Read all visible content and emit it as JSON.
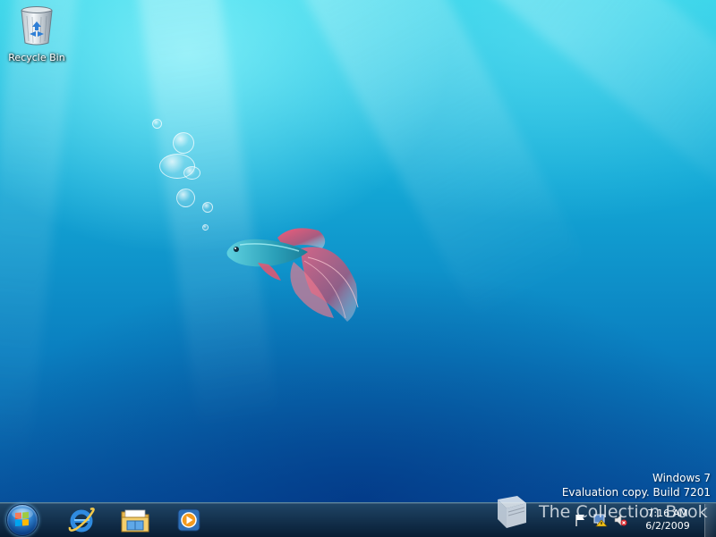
{
  "desktop": {
    "icons": [
      {
        "label": "Recycle Bin",
        "icon": "recycle-bin-icon"
      }
    ],
    "wallpaper": "betta-fish-underwater",
    "watermark": {
      "line1": "Windows 7",
      "line2": "Evaluation copy. Build 7201"
    },
    "site_watermark": "The Collection Book"
  },
  "taskbar": {
    "start": {
      "icon": "windows-start-orb-icon"
    },
    "pinned": [
      {
        "icon": "internet-explorer-icon"
      },
      {
        "icon": "windows-explorer-icon"
      },
      {
        "icon": "windows-media-player-icon"
      }
    ],
    "tray": {
      "icons": [
        "action-center-flag-icon",
        "network-disconnected-icon",
        "volume-muted-icon"
      ],
      "time": "7:16 AM",
      "date": "6/2/2009"
    }
  },
  "colors": {
    "wallpaper_top": "#2ed0e6",
    "wallpaper_bottom": "#07539e",
    "taskbar": "#0a2c4f"
  }
}
